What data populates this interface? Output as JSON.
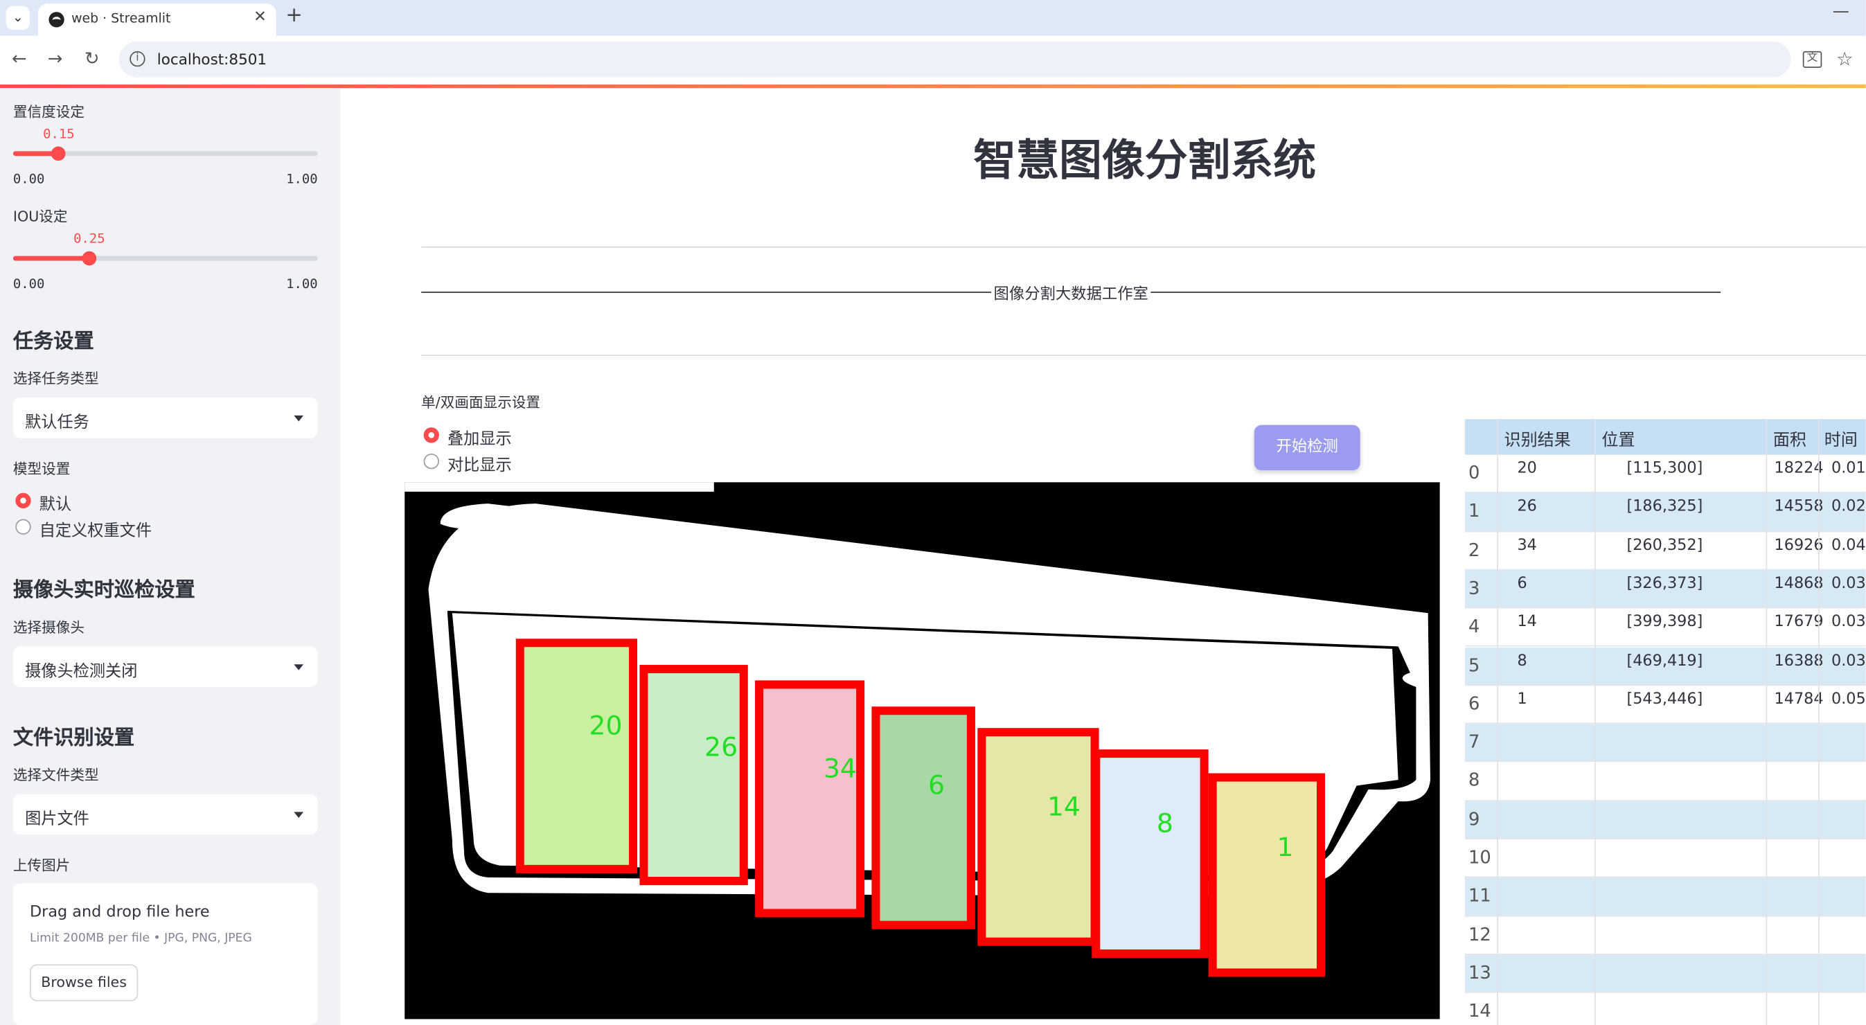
{
  "browser": {
    "tab_title": "web · Streamlit",
    "url": "localhost:8501"
  },
  "sidebar": {
    "confidence": {
      "label": "置信度设定",
      "value": "0.15",
      "value_num": 0.15,
      "min": "0.00",
      "max": "1.00"
    },
    "iou": {
      "label": "IOU设定",
      "value": "0.25",
      "value_num": 0.25,
      "min": "0.00",
      "max": "1.00"
    },
    "task_settings": {
      "heading": "任务设置",
      "label": "选择任务类型",
      "selected": "默认任务"
    },
    "model_settings": {
      "label": "模型设置",
      "options": [
        "默认",
        "自定义权重文件"
      ],
      "selected_index": 0
    },
    "camera_settings": {
      "heading": "摄像头实时巡检设置",
      "label": "选择摄像头",
      "selected": "摄像头检测关闭"
    },
    "file_settings": {
      "heading": "文件识别设置",
      "label": "选择文件类型",
      "selected": "图片文件"
    },
    "upload": {
      "label": "上传图片",
      "title": "Drag and drop file here",
      "limit": "Limit 200MB per file • JPG, PNG, JPEG",
      "button": "Browse files"
    }
  },
  "main": {
    "title": "智慧图像分割系统",
    "caption": "图像分割大数据工作室",
    "display_mode": {
      "label": "单/双画面显示设置",
      "options": [
        "叠加显示",
        "对比显示"
      ],
      "selected_index": 0
    },
    "start_button": "开始检测"
  },
  "detections": [
    {
      "label": "20",
      "color": "#c8f0a0"
    },
    {
      "label": "26",
      "color": "#c8ecc8"
    },
    {
      "label": "34",
      "color": "#f5c0cc"
    },
    {
      "label": "6",
      "color": "#a8d8a8"
    },
    {
      "label": "14",
      "color": "#e6e6a8"
    },
    {
      "label": "8",
      "color": "#dcecf8"
    },
    {
      "label": "1",
      "color": "#eee8a8"
    }
  ],
  "table": {
    "columns": [
      "识别结果",
      "位置",
      "面积",
      "时间"
    ],
    "rows": [
      {
        "idx": "0",
        "result": "20",
        "pos": "[115,300]",
        "area": "18224",
        "time": "0.01"
      },
      {
        "idx": "1",
        "result": "26",
        "pos": "[186,325]",
        "area": "14558",
        "time": "0.02"
      },
      {
        "idx": "2",
        "result": "34",
        "pos": "[260,352]",
        "area": "16926",
        "time": "0.04"
      },
      {
        "idx": "3",
        "result": "6",
        "pos": "[326,373]",
        "area": "14868",
        "time": "0.03"
      },
      {
        "idx": "4",
        "result": "14",
        "pos": "[399,398]",
        "area": "17679",
        "time": "0.03"
      },
      {
        "idx": "5",
        "result": "8",
        "pos": "[469,419]",
        "area": "16388",
        "time": "0.03"
      },
      {
        "idx": "6",
        "result": "1",
        "pos": "[543,446]",
        "area": "14784",
        "time": "0.05"
      },
      {
        "idx": "7",
        "result": "",
        "pos": "",
        "area": "",
        "time": ""
      },
      {
        "idx": "8",
        "result": "",
        "pos": "",
        "area": "",
        "time": ""
      },
      {
        "idx": "9",
        "result": "",
        "pos": "",
        "area": "",
        "time": ""
      },
      {
        "idx": "10",
        "result": "",
        "pos": "",
        "area": "",
        "time": ""
      },
      {
        "idx": "11",
        "result": "",
        "pos": "",
        "area": "",
        "time": ""
      },
      {
        "idx": "12",
        "result": "",
        "pos": "",
        "area": "",
        "time": ""
      },
      {
        "idx": "13",
        "result": "",
        "pos": "",
        "area": "",
        "time": ""
      },
      {
        "idx": "14",
        "result": "",
        "pos": "",
        "area": "",
        "time": ""
      }
    ]
  },
  "colors": {
    "accent": "#ff4b4b",
    "button": "#9b9cf0",
    "table_alt": "#d8e9f6",
    "table_head": "#c6dff3",
    "box": "#ff0000",
    "label_text": "#22dd22"
  }
}
